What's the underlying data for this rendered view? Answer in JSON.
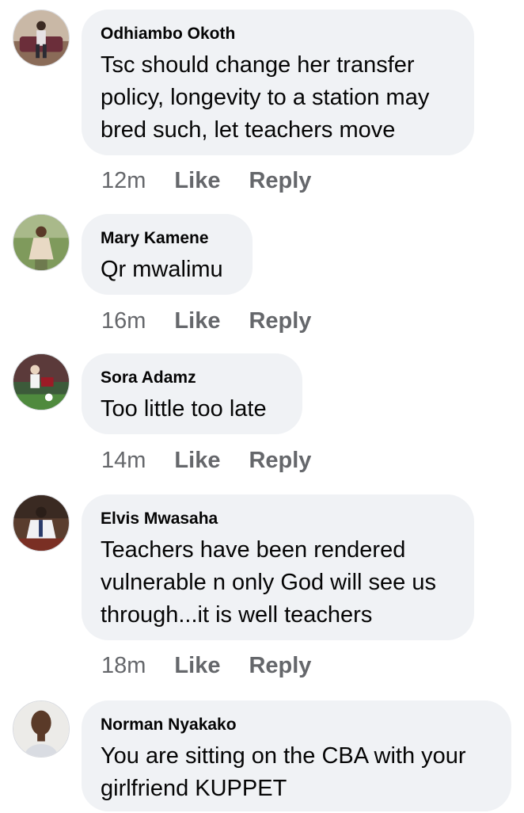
{
  "comments": [
    {
      "author": "Odhiambo Okoth",
      "text": "Tsc should change her transfer\npolicy, longevity to a station may\nbred such, let teachers move",
      "time": "12m",
      "like_label": "Like",
      "reply_label": "Reply"
    },
    {
      "author": "Mary Kamene",
      "text": "Qr mwalimu",
      "time": "16m",
      "like_label": "Like",
      "reply_label": "Reply"
    },
    {
      "author": "Sora Adamz",
      "text": "Too little too late",
      "time": "14m",
      "like_label": "Like",
      "reply_label": "Reply"
    },
    {
      "author": "Elvis Mwasaha",
      "text": "Teachers have been rendered\nvulnerable n only God will see us\nthrough...it is well teachers",
      "time": "18m",
      "like_label": "Like",
      "reply_label": "Reply"
    },
    {
      "author": "Norman Nyakako",
      "text": "You are sitting on the CBA with your\ngirlfriend KUPPET"
    }
  ],
  "colors": {
    "bubble": "#f0f2f5",
    "text": "#050505",
    "secondary": "#65676b"
  }
}
